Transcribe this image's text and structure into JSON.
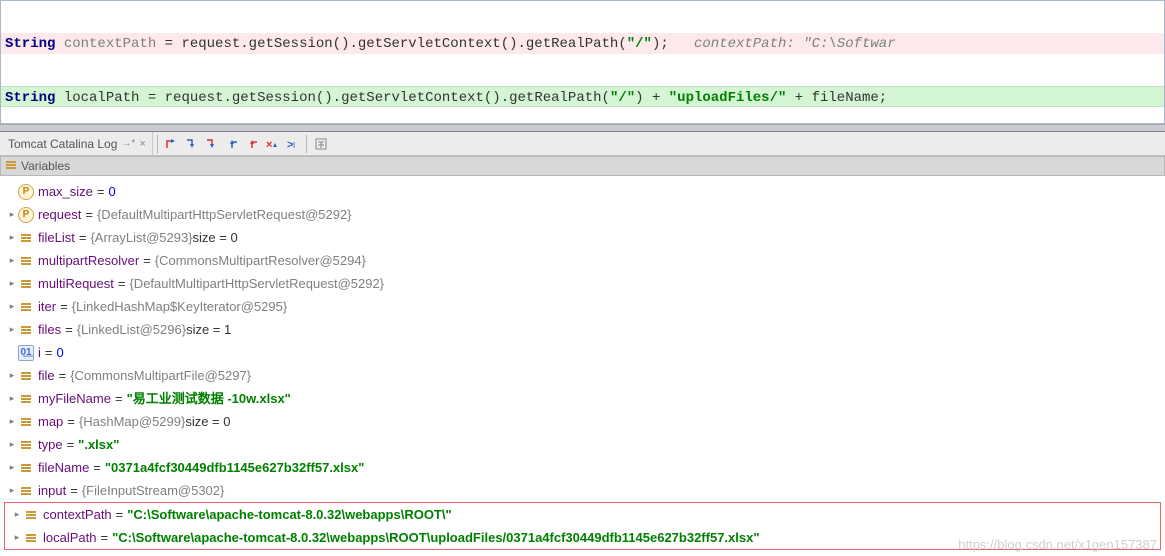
{
  "editor": {
    "line1": {
      "kw": "String",
      "var": "contextPath",
      "rest": " = request.getSession().getServletContext().getRealPath(",
      "str": "\"/\"",
      "tail": ");",
      "comment": "   contextPath: \"C:\\Softwar"
    },
    "line2": {
      "kw": "String",
      "var": "localPath",
      "rest": " = request.getSession().getServletContext().getRealPath(",
      "str1": "\"/\"",
      "mid": ") + ",
      "str2": "\"uploadFiles/\"",
      "plus": " + fileName;"
    }
  },
  "toolbar": {
    "tab_label": "Tomcat Catalina Log"
  },
  "panel": {
    "header": "Variables"
  },
  "vars": {
    "max_size": {
      "name": "max_size",
      "val": "0"
    },
    "request": {
      "name": "request",
      "val": "{DefaultMultipartHttpServletRequest@5292}"
    },
    "fileList": {
      "name": "fileList",
      "val": "{ArrayList@5293}",
      "extra": "  size = 0"
    },
    "multipartResolver": {
      "name": "multipartResolver",
      "val": "{CommonsMultipartResolver@5294}"
    },
    "multiRequest": {
      "name": "multiRequest",
      "val": "{DefaultMultipartHttpServletRequest@5292}"
    },
    "iter": {
      "name": "iter",
      "val": "{LinkedHashMap$KeyIterator@5295}"
    },
    "files": {
      "name": "files",
      "val": "{LinkedList@5296}",
      "extra": "  size = 1"
    },
    "i": {
      "name": "i",
      "val": "0"
    },
    "file": {
      "name": "file",
      "val": "{CommonsMultipartFile@5297}"
    },
    "myFileName": {
      "name": "myFileName",
      "val": "\"易工业测试数据 -10w.xlsx\""
    },
    "map": {
      "name": "map",
      "val": "{HashMap@5299}",
      "extra": "  size = 0"
    },
    "type": {
      "name": "type",
      "val": "\".xlsx\""
    },
    "fileName": {
      "name": "fileName",
      "val": "\"0371a4fcf30449dfb1145e627b32ff57.xlsx\""
    },
    "input": {
      "name": "input",
      "val": "{FileInputStream@5302}"
    },
    "contextPath": {
      "name": "contextPath",
      "val": "\"C:\\Software\\apache-tomcat-8.0.32\\webapps\\ROOT\\\""
    },
    "localPath": {
      "name": "localPath",
      "val": "\"C:\\Software\\apache-tomcat-8.0.32\\webapps\\ROOT\\uploadFiles/0371a4fcf30449dfb1145e627b32ff57.xlsx\""
    }
  },
  "watermark": "https://blog.csdn.net/x1gen157387"
}
